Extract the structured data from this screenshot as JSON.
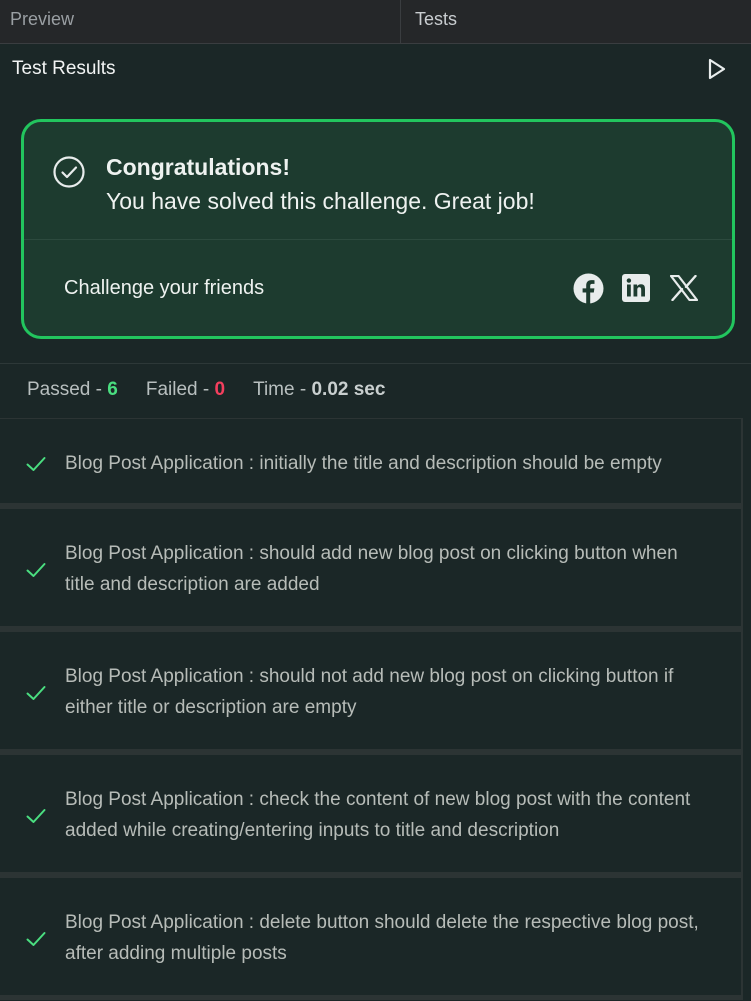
{
  "tabs": [
    {
      "label": "Preview"
    },
    {
      "label": "Tests"
    }
  ],
  "results": {
    "title": "Test Results",
    "run_icon": "play-icon"
  },
  "success": {
    "icon": "check-circle-icon",
    "title": "Congratulations!",
    "message": "You have solved this challenge. Great job!",
    "challenge_label": "Challenge your friends",
    "social": [
      "facebook-icon",
      "linkedin-icon",
      "x-icon"
    ],
    "accent_color": "#22c55e"
  },
  "summary": {
    "passed_label": "Passed - ",
    "passed_value": "6",
    "failed_label": "Failed - ",
    "failed_value": "0",
    "time_label": "Time - ",
    "time_value": "0.02 sec",
    "passed_color": "#4ade80",
    "failed_color": "#f43f5e"
  },
  "tests": [
    {
      "status": "passed",
      "text": "Blog Post Application : initially the title and description should be empty"
    },
    {
      "status": "passed",
      "text": "Blog Post Application : should add new blog post on clicking button when title and description are added"
    },
    {
      "status": "passed",
      "text": "Blog Post Application : should not add new blog post on clicking button if either title or description are empty"
    },
    {
      "status": "passed",
      "text": "Blog Post Application : check the content of new blog post with the content added while creating/entering inputs to title and description"
    },
    {
      "status": "passed",
      "text": "Blog Post Application : delete button should delete the respective blog post, after adding multiple posts"
    }
  ]
}
